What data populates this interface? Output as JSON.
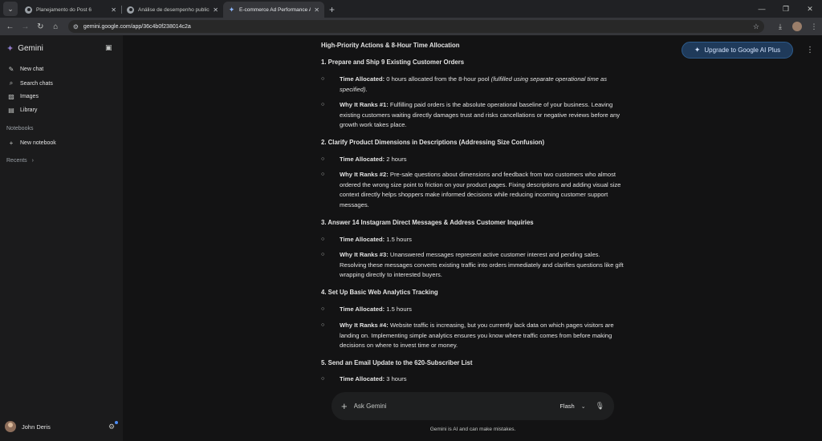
{
  "browser": {
    "tabs": [
      {
        "title": "Planejamento do Post 6"
      },
      {
        "title": "Análise de desempenho publici"
      },
      {
        "title": "E-commerce Ad Performance A"
      }
    ],
    "url": "gemini.google.com/app/36c4b0f238014c2a"
  },
  "sidebar": {
    "brand": "Gemini",
    "items": [
      {
        "label": "New chat",
        "icon": "edit-icon"
      },
      {
        "label": "Search chats",
        "icon": "search-icon"
      },
      {
        "label": "Images",
        "icon": "image-icon"
      },
      {
        "label": "Library",
        "icon": "library-icon"
      }
    ],
    "notebooks_label": "Notebooks",
    "new_notebook": "New notebook",
    "recents_label": "Recents",
    "user_name": "John Deris"
  },
  "header": {
    "upgrade_label": "Upgrade to Google AI Plus"
  },
  "content": {
    "title": "High-Priority Actions & 8-Hour Time Allocation",
    "s1": {
      "heading": "1. Prepare and Ship 9 Existing Customer Orders",
      "b1_label": "Time Allocated:",
      "b1_text": " 0 hours allocated from the 8-hour pool ",
      "b1_italic": "(fulfilled using separate operational time as specified)",
      "b1_end": ".",
      "b2_label": "Why It Ranks #1:",
      "b2_text": " Fulfilling paid orders is the absolute operational baseline of your business. Leaving existing customers waiting directly damages trust and risks cancellations or negative reviews before any growth work takes place."
    },
    "s2": {
      "heading": "2. Clarify Product Dimensions in Descriptions (Addressing Size Confusion)",
      "b1_label": "Time Allocated:",
      "b1_text": " 2 hours",
      "b2_label": "Why It Ranks #2:",
      "b2_text": " Pre-sale questions about dimensions and feedback from two customers who almost ordered the wrong size point to friction on your product pages. Fixing descriptions and adding visual size context directly helps shoppers make informed decisions while reducing incoming customer support messages."
    },
    "s3": {
      "heading": "3. Answer 14 Instagram Direct Messages & Address Customer Inquiries",
      "b1_label": "Time Allocated:",
      "b1_text": " 1.5 hours",
      "b2_label": "Why It Ranks #3:",
      "b2_text": " Unanswered messages represent active customer interest and pending sales. Resolving these messages converts existing traffic into orders immediately and clarifies questions like gift wrapping directly to interested buyers."
    },
    "s4": {
      "heading": "4. Set Up Basic Web Analytics Tracking",
      "b1_label": "Time Allocated:",
      "b1_text": " 1.5 hours",
      "b2_label": "Why It Ranks #4:",
      "b2_text": " Website traffic is increasing, but you currently lack data on which pages visitors are landing on. Implementing simple analytics ensures you know where traffic comes from before making decisions on where to invest time or money."
    },
    "s5": {
      "heading": "5. Send an Email Update to the 620-Subscriber List",
      "b1_label": "Time Allocated:",
      "b1_text": " 3 hours"
    }
  },
  "composer": {
    "placeholder": "Ask Gemini",
    "model": "Flash"
  },
  "disclaimer": "Gemini is AI and can make mistakes."
}
